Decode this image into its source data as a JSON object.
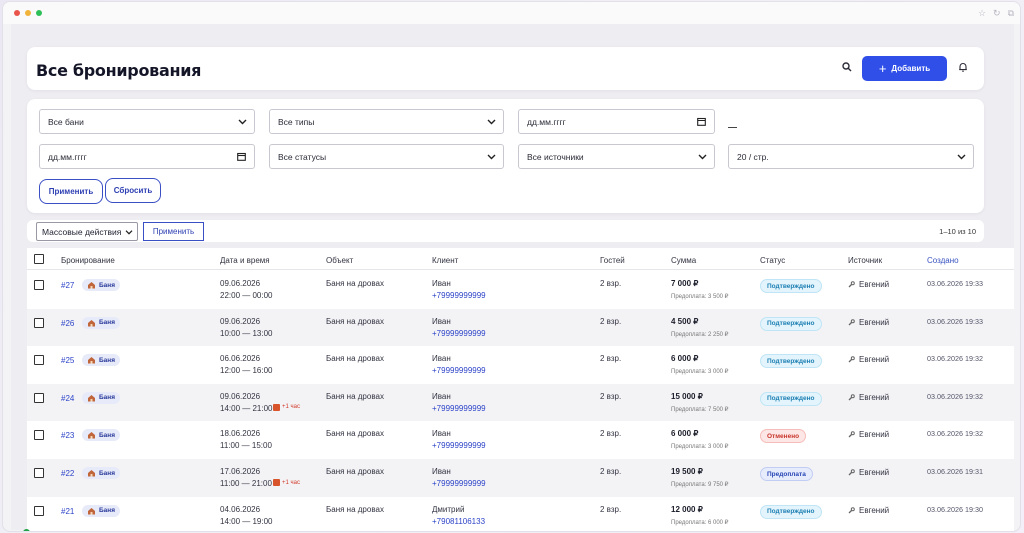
{
  "window": {
    "dot_colors": [
      "#e9544b",
      "#f2b33a",
      "#2fbf58"
    ]
  },
  "header": {
    "title": "Все бронирования",
    "add_label": "Добавить"
  },
  "filters": {
    "bath": "Все бани",
    "types": "Все типы",
    "date_from": "дд.мм.гггг",
    "date_to": "дд.мм.гггг",
    "statuses": "Все статусы",
    "sources": "Все источники",
    "per_page": "20 / стр.",
    "apply": "Применить",
    "reset": "Сбросить"
  },
  "bulk": {
    "actions": "Массовые действия",
    "apply": "Применить",
    "range": "1–10 из 10"
  },
  "table": {
    "headers": {
      "booking": "Бронирование",
      "datetime": "Дата и время",
      "object": "Объект",
      "client": "Клиент",
      "guests": "Гостей",
      "sum": "Сумма",
      "status": "Статус",
      "source": "Источник",
      "created": "Создано"
    },
    "rows": [
      {
        "id": "#27",
        "tag": "Баня",
        "date": "09.06.2026",
        "time": "22:00 — 00:00",
        "extra": "",
        "object": "Баня на дровах",
        "client": "Иван",
        "phone": "+79999999999",
        "guests": "2 взр.",
        "sum": "7 000 ₽",
        "prepay": "Предоплата: 3 500 ₽",
        "status": "Подтверждено",
        "status_kind": "ok",
        "source": "Евгений",
        "created": "03.06.2026 19:33"
      },
      {
        "id": "#26",
        "tag": "Баня",
        "date": "09.06.2026",
        "time": "10:00 — 13:00",
        "extra": "",
        "object": "Баня на дровах",
        "client": "Иван",
        "phone": "+79999999999",
        "guests": "2 взр.",
        "sum": "4 500 ₽",
        "prepay": "Предоплата: 2 250 ₽",
        "status": "Подтверждено",
        "status_kind": "ok",
        "source": "Евгений",
        "created": "03.06.2026 19:33"
      },
      {
        "id": "#25",
        "tag": "Баня",
        "date": "06.06.2026",
        "time": "12:00 — 16:00",
        "extra": "",
        "object": "Баня на дровах",
        "client": "Иван",
        "phone": "+79999999999",
        "guests": "2 взр.",
        "sum": "6 000 ₽",
        "prepay": "Предоплата: 3 000 ₽",
        "status": "Подтверждено",
        "status_kind": "ok",
        "source": "Евгений",
        "created": "03.06.2026 19:32"
      },
      {
        "id": "#24",
        "tag": "Баня",
        "date": "09.06.2026",
        "time": "14:00 — 21:00",
        "extra": "+1 час",
        "object": "Баня на дровах",
        "client": "Иван",
        "phone": "+79999999999",
        "guests": "2 взр.",
        "sum": "15 000 ₽",
        "prepay": "Предоплата: 7 500 ₽",
        "status": "Подтверждено",
        "status_kind": "ok",
        "source": "Евгений",
        "created": "03.06.2026 19:32"
      },
      {
        "id": "#23",
        "tag": "Баня",
        "date": "18.06.2026",
        "time": "11:00 — 15:00",
        "extra": "",
        "object": "Баня на дровах",
        "client": "Иван",
        "phone": "+79999999999",
        "guests": "2 взр.",
        "sum": "6 000 ₽",
        "prepay": "Предоплата: 3 000 ₽",
        "status": "Отменено",
        "status_kind": "cancel",
        "source": "Евгений",
        "created": "03.06.2026 19:32"
      },
      {
        "id": "#22",
        "tag": "Баня",
        "date": "17.06.2026",
        "time": "11:00 — 21:00",
        "extra": "+1 час",
        "object": "Баня на дровах",
        "client": "Иван",
        "phone": "+79999999999",
        "guests": "2 взр.",
        "sum": "19 500 ₽",
        "prepay": "Предоплата: 9 750 ₽",
        "status": "Предоплата",
        "status_kind": "prepay",
        "source": "Евгений",
        "created": "03.06.2026 19:31"
      },
      {
        "id": "#21",
        "tag": "Баня",
        "date": "04.06.2026",
        "time": "14:00 — 19:00",
        "extra": "",
        "object": "Баня на дровах",
        "client": "Дмитрий",
        "phone": "+79081106133",
        "guests": "2 взр.",
        "sum": "12 000 ₽",
        "prepay": "Предоплата: 6 000 ₽",
        "status": "Подтверждено",
        "status_kind": "ok",
        "source": "Евгений",
        "created": "03.06.2026 19:30"
      }
    ]
  }
}
